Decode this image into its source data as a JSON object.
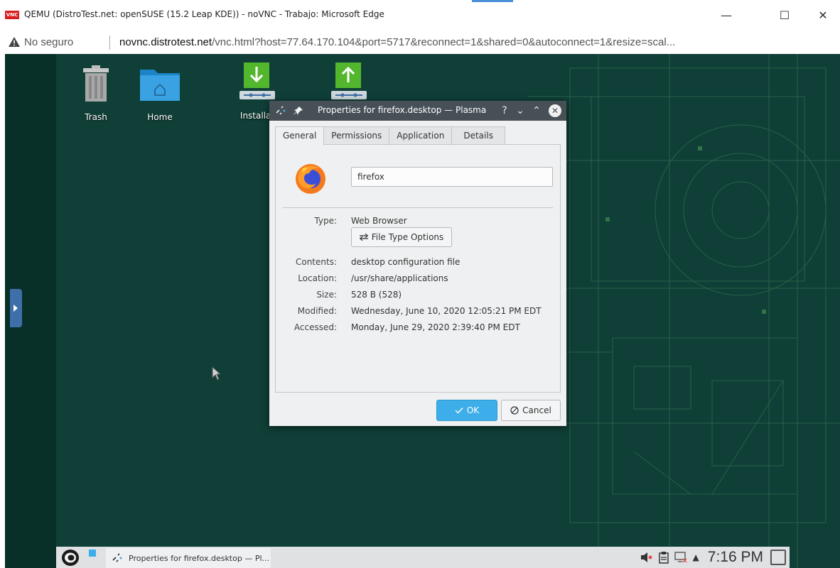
{
  "browser": {
    "window_title": "QEMU (DistroTest.net: openSUSE (15.2 Leap KDE)) - noVNC - Trabajo: Microsoft Edge",
    "app_badge": "VNC",
    "controls": {
      "minimize": "—",
      "maximize": "☐",
      "close": "✕"
    },
    "security_label": "No seguro",
    "url_host": "novnc.distrotest.net",
    "url_rest": "/vnc.html?host=77.64.170.104&port=5717&reconnect=1&shared=0&autoconnect=1&resize=scal..."
  },
  "desktop": {
    "icons": [
      {
        "label": "Trash",
        "icon": "trash-icon"
      },
      {
        "label": "Home",
        "icon": "home-folder-icon"
      },
      {
        "label": "Installat",
        "icon": "download-icon"
      },
      {
        "label": "",
        "icon": "upload-icon"
      }
    ]
  },
  "dialog": {
    "title": "Properties for firefox.desktop — Plasma",
    "titlebar_buttons": {
      "help": "?",
      "minimize": "⌄",
      "maximize": "⌃",
      "close": "✕"
    },
    "tabs": [
      "General",
      "Permissions",
      "Application",
      "Details"
    ],
    "active_tab": "General",
    "name_value": "firefox",
    "properties": {
      "type_label": "Type:",
      "type_value": "Web Browser",
      "file_type_button": "File Type Options",
      "contents_label": "Contents:",
      "contents_value": "desktop configuration file",
      "location_label": "Location:",
      "location_value": "/usr/share/applications",
      "size_label": "Size:",
      "size_value": "528 B (528)",
      "modified_label": "Modified:",
      "modified_value": "Wednesday, June 10, 2020 12:05:21 PM EDT",
      "accessed_label": "Accessed:",
      "accessed_value": "Monday, June 29, 2020 2:39:40 PM EDT"
    },
    "ok_label": "OK",
    "cancel_label": "Cancel"
  },
  "taskbar": {
    "task_label": "Properties for firefox.desktop — Pl...",
    "clock": "7:16 PM",
    "tray_expand": "▲"
  },
  "colors": {
    "desktop_bg": "#0f3f37",
    "accent": "#3daee9",
    "dialog_titlebar": "#475057"
  }
}
